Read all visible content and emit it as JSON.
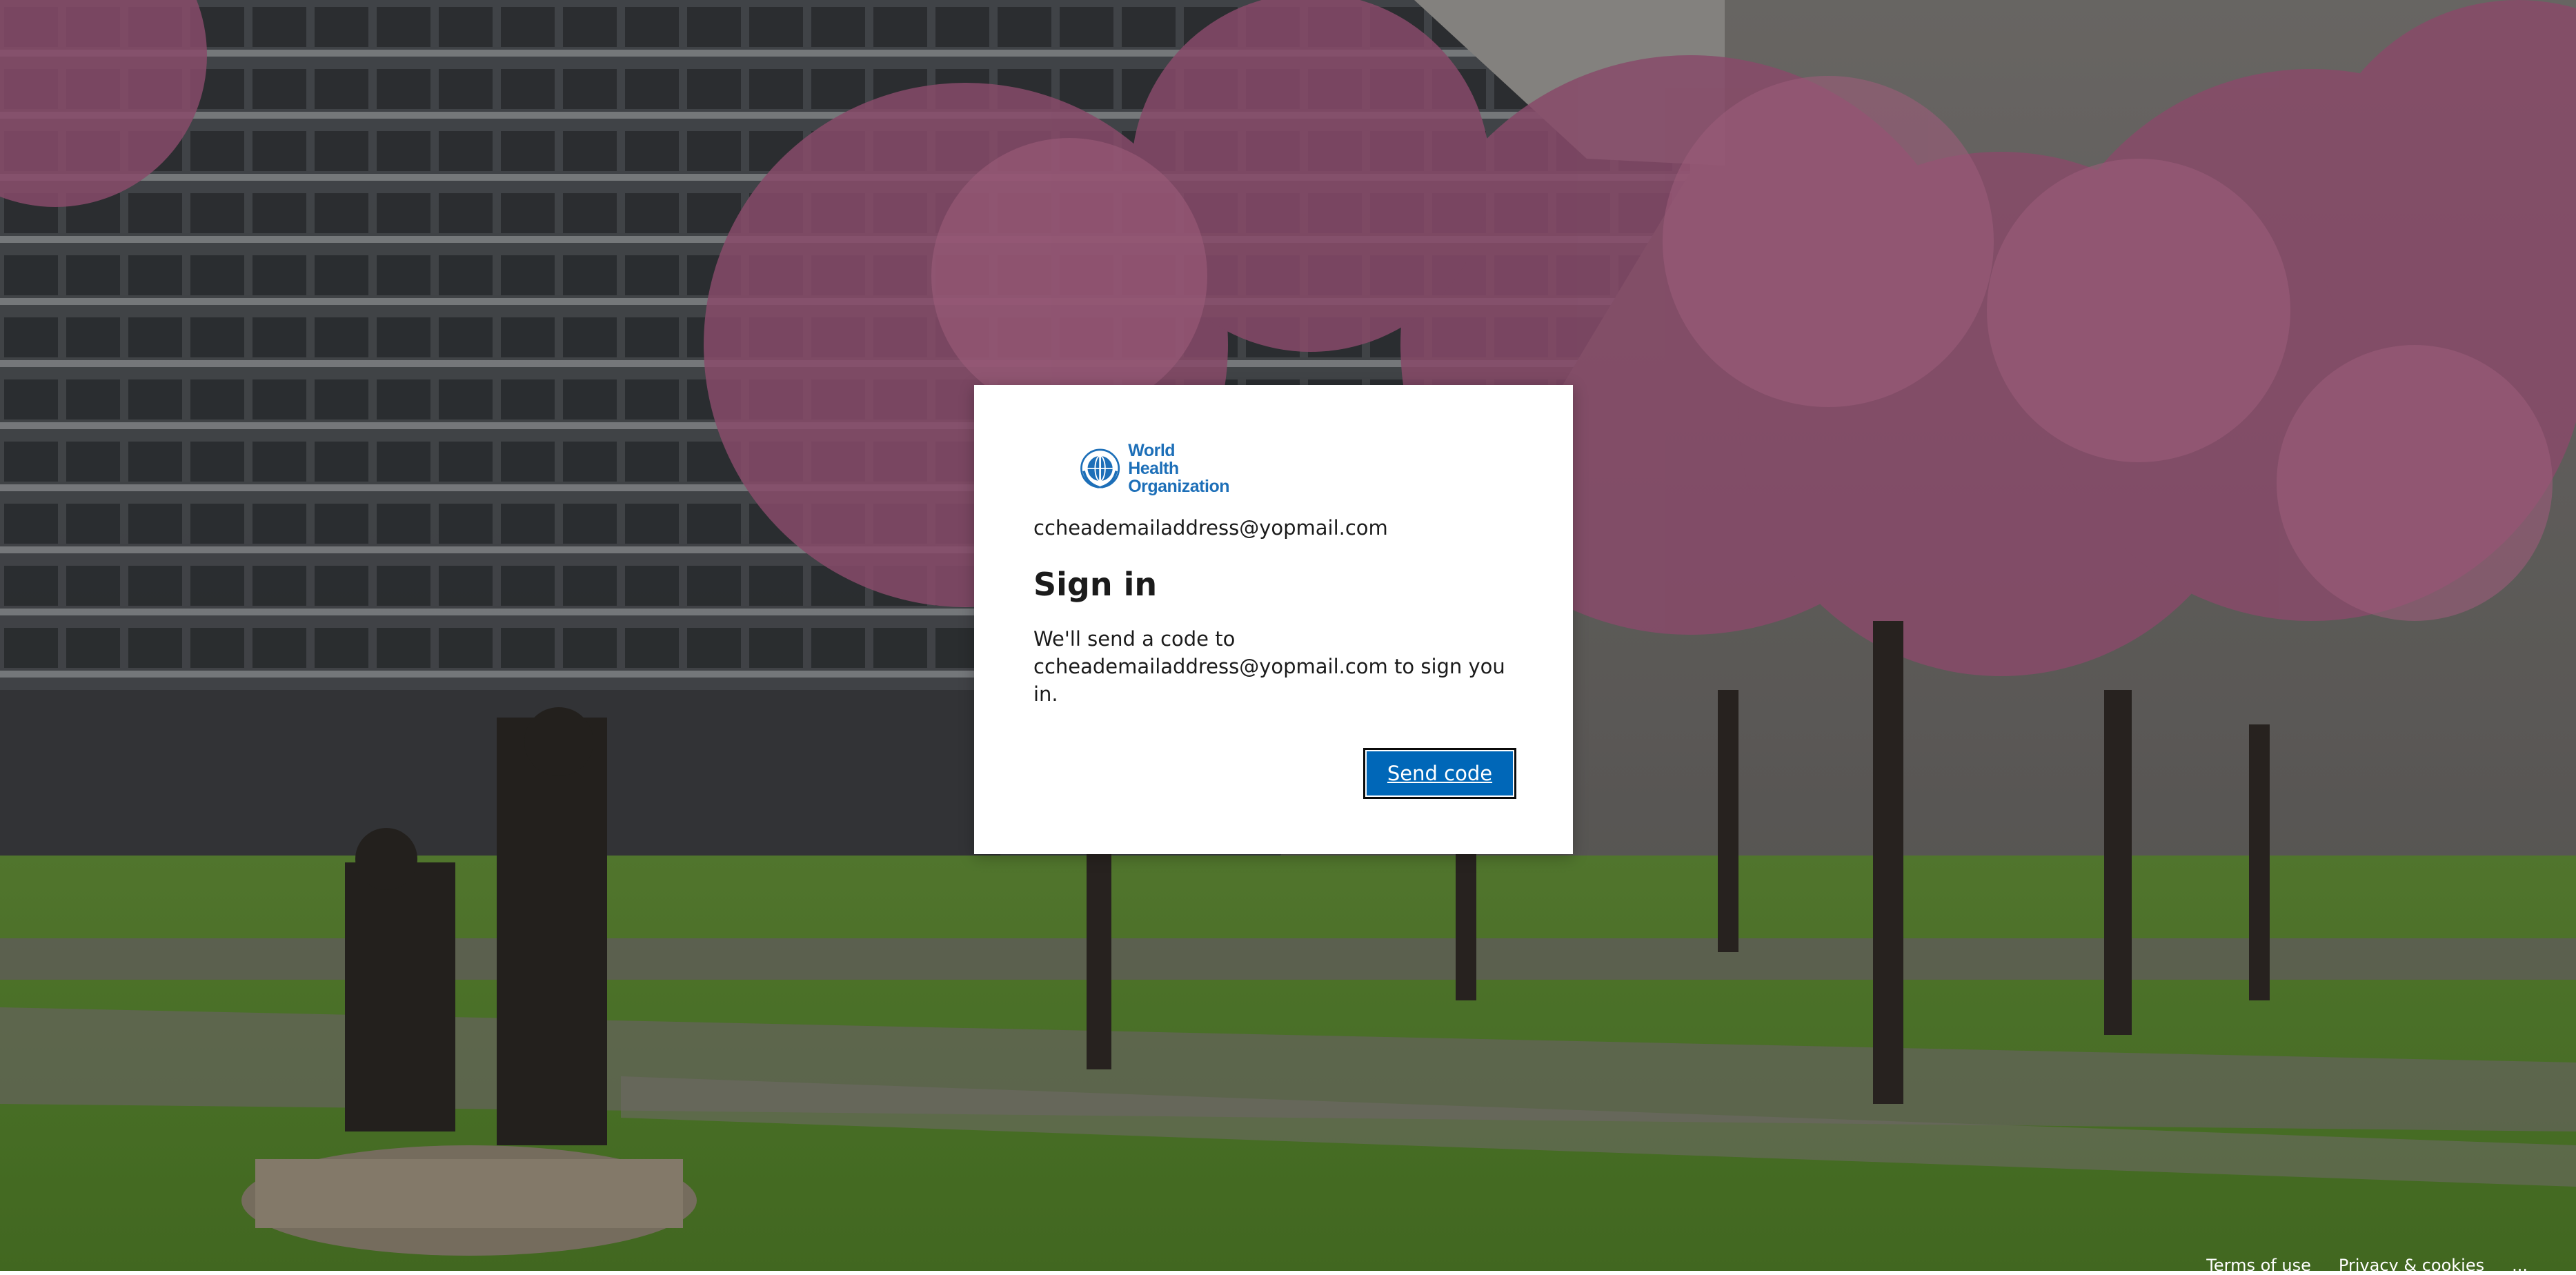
{
  "colors": {
    "accent": "#0067b8",
    "logo_blue": "#1d6fb8",
    "card_bg": "#ffffff",
    "text": "#1b1b1b"
  },
  "logo": {
    "icon": "who-emblem-icon",
    "line1": "World Health",
    "line2": "Organization"
  },
  "signin": {
    "identity": "ccheademailaddress@yopmail.com",
    "title": "Sign in",
    "description_line1": "We'll send a code to",
    "description_line2": "ccheademailaddress@yopmail.com to sign you in.",
    "send_code_label": "Send code"
  },
  "footer": {
    "terms_label": "Terms of use",
    "privacy_label": "Privacy & cookies",
    "more_label": "..."
  }
}
